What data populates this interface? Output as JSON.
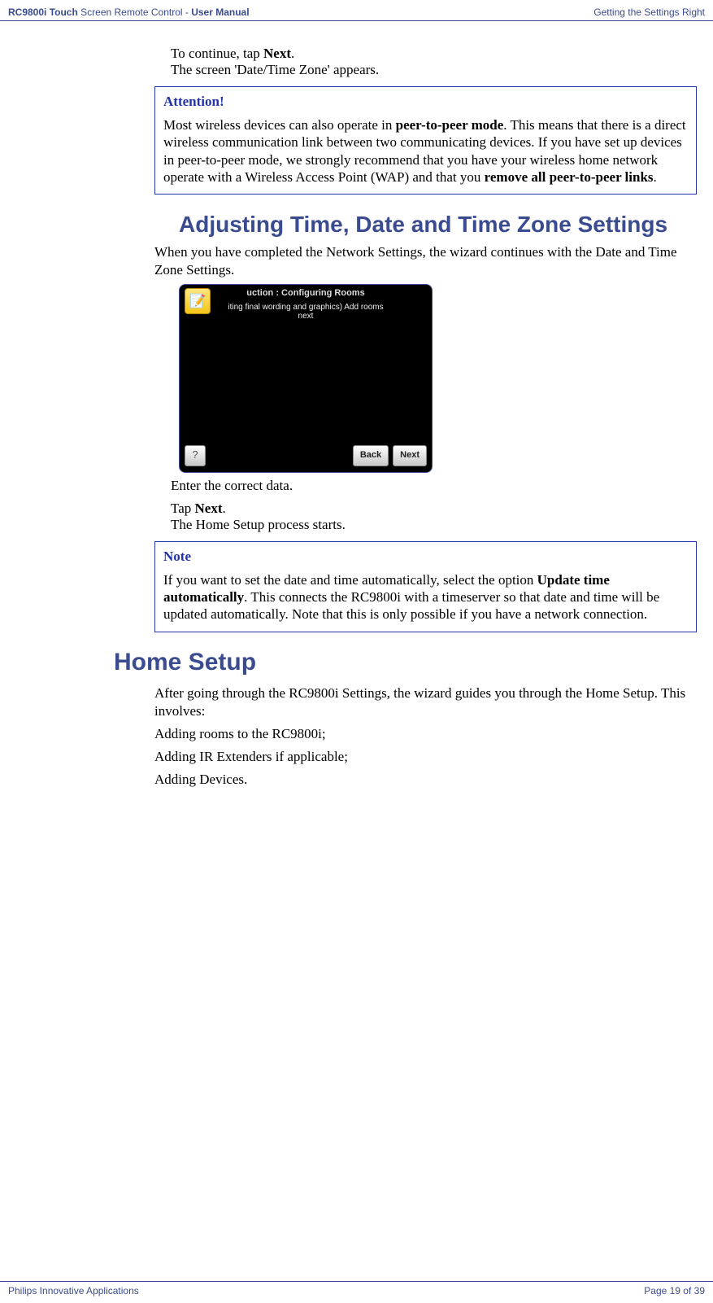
{
  "header": {
    "product_bold": "RC9800i Touch",
    "product_rest": " Screen Remote Control - ",
    "manual_bold": "User Manual",
    "right": "Getting the Settings Right"
  },
  "step_continue": {
    "pre": "To continue, tap ",
    "bold": "Next",
    "post": ".",
    "result": "The screen 'Date/Time Zone' appears."
  },
  "attention": {
    "title": "Attention!",
    "body_pre": "Most wireless devices can also operate in ",
    "bold1": "peer-to-peer mode",
    "body_mid": ". This means that there is a direct wireless communication link between two communicating devices. If you have set up devices in peer-to-peer mode, we strongly recommend that you have your wireless home network operate with a Wireless Access Point (WAP) and that you ",
    "bold2": "remove all peer-to-peer links",
    "body_post": "."
  },
  "section_adjust": "Adjusting Time, Date and Time Zone Settings",
  "adjust_intro": "When you have completed the Network Settings, the wizard continues with the Date and Time Zone Settings.",
  "screenshot": {
    "title_frag": "uction : Configuring Rooms",
    "sub_line1": "iting final wording and graphics) Add rooms",
    "sub_line2": "next",
    "help": "?",
    "back": "Back",
    "next": "Next",
    "icon": "📝"
  },
  "enter_data": "Enter the correct data.",
  "tap_next": {
    "pre": "Tap ",
    "bold": "Next",
    "post": ".",
    "result": "The Home Setup process starts."
  },
  "note2": {
    "title": "Note",
    "body_pre": "If you want to set the date and time automatically, select the option ",
    "bold": "Update time automatically",
    "body_post": ". This connects the RC9800i with a timeserver so that date and time will be updated automatically. Note that this is only possible if you have a network connection."
  },
  "section_home": "Home Setup",
  "home_intro": "After going through the RC9800i Settings, the wizard guides you through the Home Setup. This involves:",
  "bullets": {
    "b1": "Adding rooms to the RC9800i;",
    "b2": "Adding IR Extenders if applicable;",
    "b3": "Adding Devices."
  },
  "footer": {
    "left": "Philips Innovative Applications",
    "right": "Page 19 of 39"
  }
}
